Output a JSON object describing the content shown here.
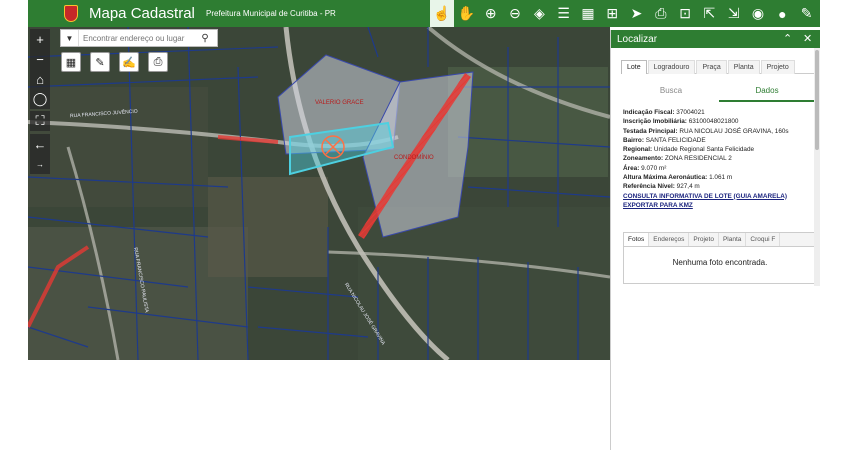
{
  "header": {
    "title": "Mapa Cadastral",
    "subtitle": "Prefeitura Municipal de Curitiba - PR"
  },
  "toolbar_icons": [
    "identify-icon",
    "pan-icon",
    "zoom-in-icon",
    "zoom-out-icon",
    "layers-icon",
    "list-icon",
    "grid-icon",
    "measure-icon",
    "pin-icon",
    "print-icon",
    "add-icon",
    "export-icon",
    "import-icon",
    "locate-icon",
    "globe-icon",
    "edit-icon",
    "compare-icon",
    "menu-icon"
  ],
  "search": {
    "placeholder": "Encontrar endereço ou lugar"
  },
  "map": {
    "labels": [
      "VALERIO GRACE",
      "CONDOMÍNIO",
      "RUA NICOLAU JOSÉ GRAVINA",
      "RUA FRANCISCO JUVÊNCIO",
      "RUA FRANCISCO PAULISTA"
    ]
  },
  "panel": {
    "title": "Localizar",
    "tabs": [
      "Lote",
      "Logradouro",
      "Praça",
      "Planta",
      "Projeto"
    ],
    "subtabs": [
      "Busca",
      "Dados"
    ],
    "info": {
      "indicacao_label": "Indicação Fiscal:",
      "indicacao": "37004021",
      "inscricao_label": "Inscrição Imobiliária:",
      "inscricao": "63100048021800",
      "testada_label": "Testada Principal:",
      "testada": "RUA NICOLAU JOSÉ GRAVINA, 160s",
      "bairro_label": "Bairro:",
      "bairro": "SANTA FELICIDADE",
      "regional_label": "Regional:",
      "regional": "Unidade Regional Santa Felicidade",
      "zoneamento_label": "Zoneamento:",
      "zoneamento": "ZONA RESIDENCIAL 2",
      "area_label": "Área:",
      "area": "9.070 m²",
      "altura_label": "Altura Máxima Aeronáutica:",
      "altura": "1.061 m",
      "referencia_label": "Referência Nível:",
      "referencia": "927,4 m",
      "link_consulta": "CONSULTA INFORMATIVA DE LOTE (GUIA AMARELA)",
      "link_kmz": "EXPORTAR PARA KMZ"
    },
    "photo_tabs": [
      "Fotos",
      "Endereços",
      "Projeto",
      "Planta",
      "Croqui F"
    ],
    "no_photo": "Nenhuma foto encontrada."
  },
  "colors": {
    "header": "#2e7d32",
    "lot_highlight": "#4dd0e1",
    "street_highlight": "#e53935",
    "parcel_lines": "#1e3a8a"
  }
}
